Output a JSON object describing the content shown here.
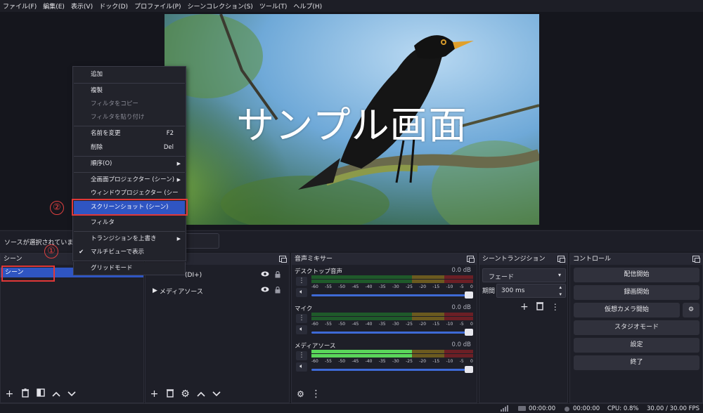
{
  "menu": [
    "ファイル(F)",
    "編集(E)",
    "表示(V)",
    "ドック(D)",
    "プロファイル(P)",
    "シーンコレクション(S)",
    "ツール(T)",
    "ヘルプ(H)"
  ],
  "preview": {
    "overlay_text": "サンプル画面"
  },
  "status_bar_text": "ソースが選択されていません",
  "docks": {
    "scenes": {
      "title": "シーン",
      "items": [
        "シーン"
      ]
    },
    "sources": {
      "items": [
        "(DI+)",
        "メディアソース"
      ]
    },
    "mixer": {
      "title": "音声ミキサー",
      "channels": [
        {
          "name": "デスクトップ音声",
          "db": "0.0 dB",
          "level": 0
        },
        {
          "name": "マイク",
          "db": "0.0 dB",
          "level": 0
        },
        {
          "name": "メディアソース",
          "db": "0.0 dB",
          "level": 0.62
        }
      ],
      "scale": [
        "-60",
        "-55",
        "-50",
        "-45",
        "-40",
        "-35",
        "-30",
        "-25",
        "-20",
        "-15",
        "-10",
        "-5",
        "0"
      ]
    },
    "transitions": {
      "title": "シーントランジション",
      "type": "フェード",
      "duration_label": "期間",
      "duration": "300 ms"
    },
    "controls": {
      "title": "コントロール",
      "buttons": [
        "配信開始",
        "録画開始",
        "仮想カメラ開始",
        "スタジオモード",
        "設定",
        "終了"
      ]
    }
  },
  "context_menu": {
    "items": [
      {
        "label": "追加",
        "shortcut": ""
      },
      {
        "label": "複製",
        "shortcut": ""
      },
      {
        "label": "フィルタをコピー",
        "shortcut": ""
      },
      {
        "label": "フィルタを貼り付け",
        "shortcut": ""
      },
      {
        "label": "名前を変更",
        "shortcut": "F2"
      },
      {
        "label": "削除",
        "shortcut": "Del"
      },
      {
        "label": "順序(O)",
        "shortcut": ""
      },
      {
        "label": "全画面プロジェクター (シーン)",
        "shortcut": ""
      },
      {
        "label": "ウィンドウプロジェクター (シーン)",
        "shortcut": ""
      },
      {
        "label": "スクリーンショット (シーン)",
        "shortcut": ""
      },
      {
        "label": "フィルタ",
        "shortcut": ""
      },
      {
        "label": "トランジションを上書き",
        "shortcut": ""
      },
      {
        "label": "マルチビューで表示",
        "shortcut": ""
      },
      {
        "label": "グリッドモード",
        "shortcut": ""
      }
    ]
  },
  "annotations": [
    "①",
    "②"
  ],
  "bottom_status": {
    "time1": "00:00:00",
    "time2": "00:00:00",
    "cpu": "CPU: 0.8%",
    "fps": "30.00 / 30.00 FPS"
  },
  "colors": {
    "accent": "#2f55c2",
    "annotation": "#e03838"
  },
  "icons": [
    "eye-icon",
    "lock-icon",
    "plus-icon",
    "trash-icon",
    "gear-icon",
    "kebab-icon",
    "speaker-icon",
    "float-icon",
    "chevron-up-icon",
    "chevron-down-icon"
  ]
}
